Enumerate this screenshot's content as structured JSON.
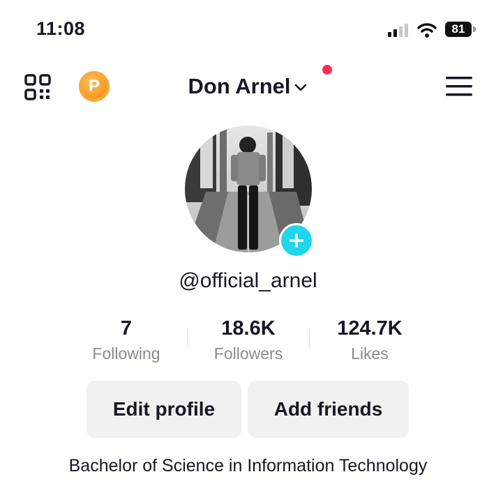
{
  "status_bar": {
    "time": "11:08",
    "battery": "81"
  },
  "header": {
    "title": "Don Arnel",
    "coin_label": "P",
    "icons": [
      "qr-code-icon",
      "chevron-down-icon",
      "hamburger-menu-icon"
    ],
    "notification_dot_color": "#fe2c55"
  },
  "profile": {
    "username": "@official_arnel",
    "add_badge_color": "#20d5ec"
  },
  "stats": [
    {
      "value": "7",
      "label": "Following"
    },
    {
      "value": "18.6K",
      "label": "Followers"
    },
    {
      "value": "124.7K",
      "label": "Likes"
    }
  ],
  "actions": {
    "edit_profile": "Edit profile",
    "add_friends": "Add friends"
  },
  "bio": "Bachelor of Science in Information Technology"
}
